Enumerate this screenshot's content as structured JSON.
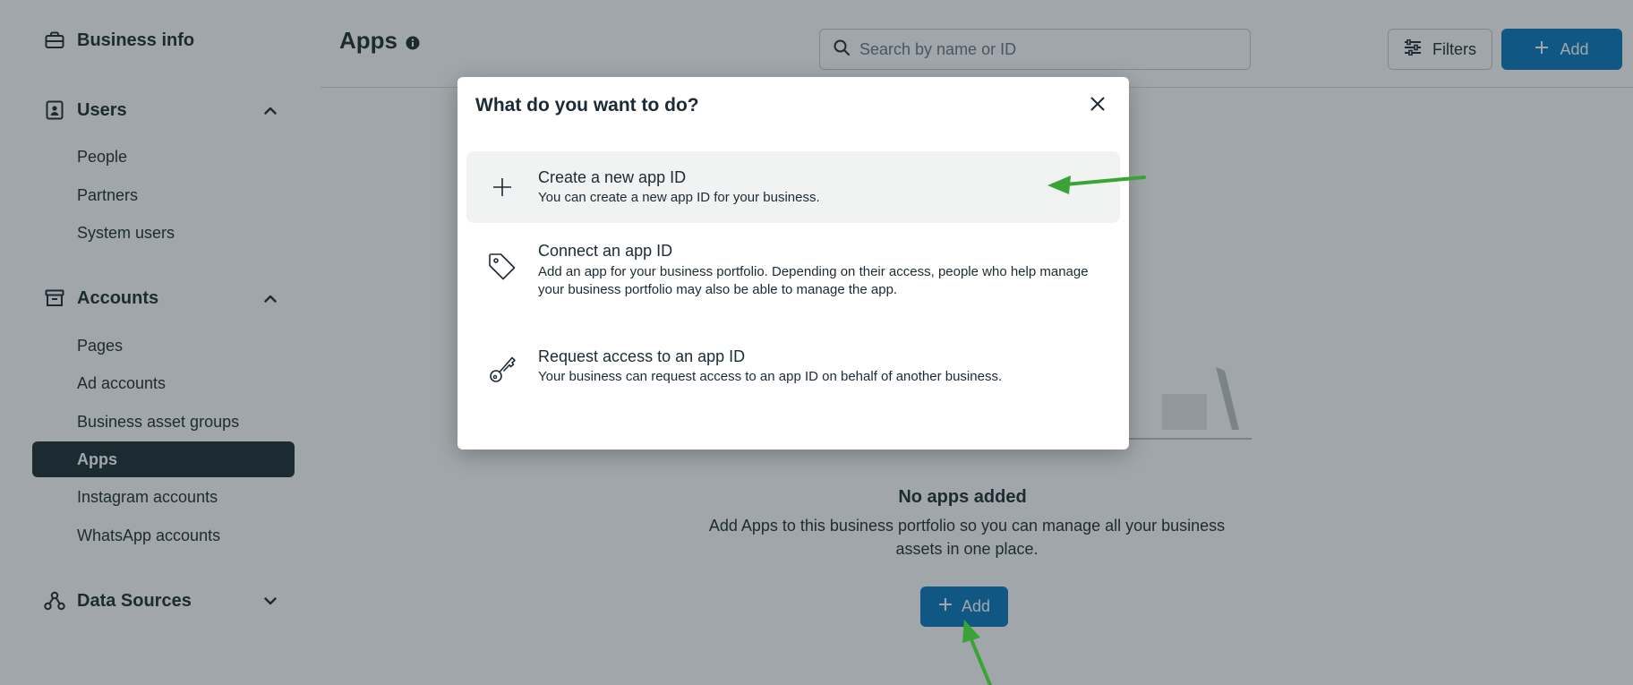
{
  "sidebar": {
    "business_info": "Business info",
    "sections": {
      "users": "Users",
      "accounts": "Accounts",
      "data_sources": "Data Sources"
    },
    "users_items": [
      "People",
      "Partners",
      "System users"
    ],
    "accounts_items": [
      "Pages",
      "Ad accounts",
      "Business asset groups",
      "Apps",
      "Instagram accounts",
      "WhatsApp accounts"
    ],
    "active_item": "Apps"
  },
  "header": {
    "title": "Apps",
    "search_placeholder": "Search by name or ID",
    "filters_label": "Filters",
    "add_label": "Add"
  },
  "empty_state": {
    "title": "No apps added",
    "description": "Add Apps to this business portfolio so you can manage all your business assets in one place.",
    "add_label": "Add"
  },
  "dialog": {
    "title": "What do you want to do?",
    "options": [
      {
        "title": "Create a new app ID",
        "description": "You can create a new app ID for your business.",
        "icon": "plus-icon"
      },
      {
        "title": "Connect an app ID",
        "description": "Add an app for your business portfolio. Depending on their access, people who help manage your business portfolio may also be able to manage the app.",
        "icon": "tag-icon"
      },
      {
        "title": "Request access to an app ID",
        "description": "Your business can request access to an app ID on behalf of another business.",
        "icon": "key-icon"
      }
    ]
  },
  "colors": {
    "primary": "#0a78be",
    "active_nav": "#1c2b33",
    "annotation_arrow": "#3aa335"
  }
}
